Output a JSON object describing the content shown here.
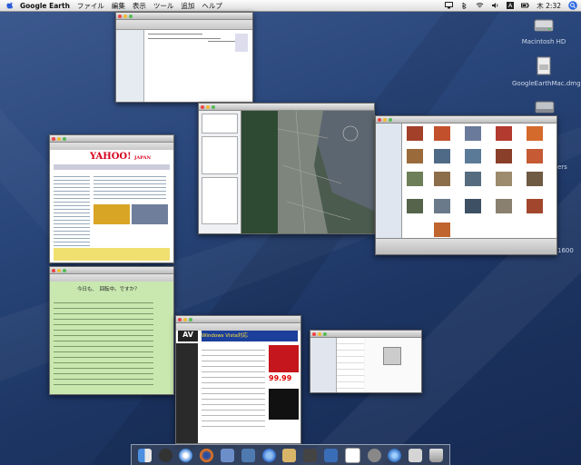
{
  "menubar": {
    "app_name": "Google Earth",
    "menus": [
      "ファイル",
      "編集",
      "表示",
      "ツール",
      "追加",
      "ヘルプ"
    ],
    "clock": "木 2:32",
    "input_indicator": "A"
  },
  "desktop_icons": [
    {
      "label": "Macintosh HD"
    },
    {
      "label": "GoogleEarthMac.dmg"
    }
  ],
  "partial_labels": {
    "right_edge_1": "ers",
    "right_edge_2": "1600"
  },
  "windows": {
    "yahoo": {
      "logo": "YAHOO!",
      "sub": "JAPAN"
    },
    "green_page": {
      "heading": "今日も、　回転中。ですか？"
    },
    "av_page": {
      "logo": "AV",
      "banner": "Windows Vista対応",
      "price": "99.99"
    }
  },
  "colors": {
    "desktop": "#1d3563",
    "yahoo_red": "#d6001c",
    "green_bg": "#c9e8b0",
    "earth_map": "#4b5b4e"
  },
  "dock": {
    "items": [
      "finder-icon",
      "dashboard-icon",
      "safari-icon",
      "firefox-icon",
      "mail-icon",
      "iphoto-icon",
      "ical-icon",
      "itunes-icon",
      "imovie-icon",
      "terminal-icon",
      "preview-icon",
      "system-preferences-icon",
      "google-earth-icon",
      "itunes-music-icon",
      "trash-icon"
    ]
  }
}
